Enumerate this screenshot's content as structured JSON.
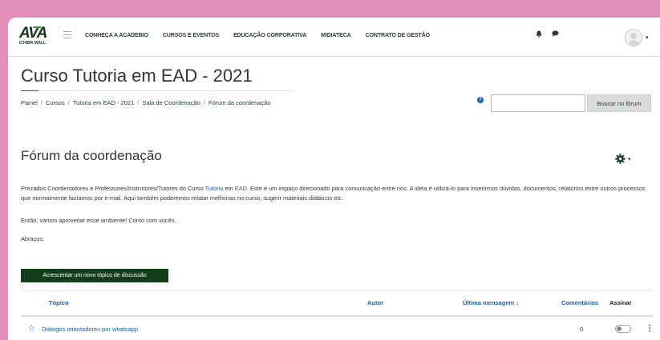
{
  "logo": {
    "text": "AVA",
    "subtext": "ICHIBR·WALL"
  },
  "nav": {
    "links": [
      "CONHEÇA A ACADEBIO",
      "CURSOS E EVENTOS",
      "EDUCAÇÃO CORPORATIVA",
      "MIDIATECA",
      "CONTRATO DE GESTÃO"
    ],
    "notification_icon": "bell-icon",
    "message_icon": "chat-bubble-icon",
    "user_menu_caret": "▾"
  },
  "course": {
    "title": "Curso Tutoria em EAD - 2021"
  },
  "breadcrumb": [
    "Painel",
    "Cursos",
    "Tutoria em EAD - 2021",
    "Sala de Coordenação",
    "Fórum da coordenação"
  ],
  "search": {
    "help_icon": "?",
    "value": "",
    "button_label": "Buscar no fórum"
  },
  "forum": {
    "title": "Fórum da coordenação",
    "settings_icon": "gear-icon",
    "description": {
      "p1_a": "Prezados Coordenadores e Professores/Instrutores/Tutores do Curso ",
      "p1_link1": "Tutoria",
      "p1_b": " em ",
      "p1_link2": "EAD",
      "p1_c": ". Este é um espaço direcionado para comunicação entre nós. A ideia é utilizá-lo para inserirmos dúvidas, documentos, relatórios entre outros processos que normalmente fazíamos por e-mail. Aqui também poderemos relatar melhorias no curso, sugerir materiais didáticos etc.",
      "p2": "Então, vamos aproveitar esse ambiente! Conto com vocês.",
      "p3": "Abraços."
    },
    "add_button": "Acrescentar um novo tópico de discussão"
  },
  "table": {
    "headers": {
      "topic": "Tópico",
      "author": "Autor",
      "last_post": "Última mensagem",
      "sort_icon": "↓",
      "comments": "Comentários",
      "subscribe": "Assinar"
    },
    "rows": [
      {
        "star": "☆",
        "topic": "Diálogos orientadores por whatsapp",
        "author": "",
        "last_post": "",
        "comments": "0",
        "subscribed": false,
        "menu": "⋮"
      }
    ]
  },
  "colors": {
    "background": "#e38fbd",
    "nav_text": "#1f4226",
    "link": "#1a5fa8",
    "primary_button": "#133d1b"
  }
}
